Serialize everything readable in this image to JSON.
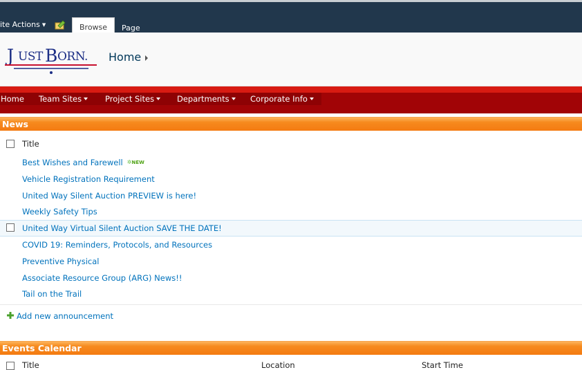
{
  "ribbon": {
    "site_actions": "ite Actions",
    "tabs": [
      "Browse",
      "Page"
    ]
  },
  "title_area": {
    "logo_text": "JUSTBORN.",
    "breadcrumb": "Home"
  },
  "nav": {
    "items": [
      "Home",
      "Team Sites",
      "Project Sites",
      "Departments",
      "Corporate Info"
    ]
  },
  "news": {
    "header": "News",
    "column_title": "Title",
    "new_badge": "NEW",
    "items": [
      "Best Wishes and Farewell",
      "Vehicle Registration Requirement",
      "United Way Silent Auction PREVIEW is here!",
      "Weekly Safety Tips",
      "United Way Virtual Silent Auction SAVE THE DATE!",
      "COVID 19: Reminders, Protocols, and Resources",
      "Preventive Physical",
      "Associate Resource Group (ARG) News!!",
      "Tail on the Trail"
    ],
    "add_link": "Add new announcement"
  },
  "events": {
    "header": "Events Calendar",
    "columns": [
      "Title",
      "Location",
      "Start Time"
    ]
  },
  "colors": {
    "ribbon_bg": "#21374c",
    "nav_red": "#a10406",
    "section_orange": "#f47b12",
    "link_blue": "#0072bc"
  }
}
